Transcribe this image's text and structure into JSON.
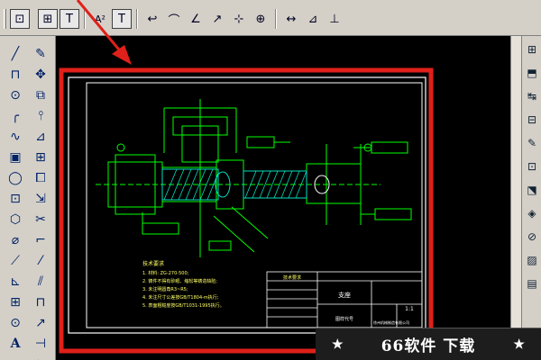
{
  "toolbar": {
    "buttons": [
      {
        "name": "zoom-extents-icon",
        "glyph": "⊡"
      },
      {
        "name": "zoom-window-icon",
        "glyph": "⊞"
      },
      {
        "name": "text-style-icon",
        "glyph": "T"
      },
      {
        "name": "superscript-text-icon",
        "glyph": "A²"
      },
      {
        "name": "multiline-text-icon",
        "glyph": "T"
      },
      {
        "name": "arrow-left-icon",
        "glyph": "↩"
      },
      {
        "name": "arc-icon",
        "glyph": "⌒"
      },
      {
        "name": "slope-icon",
        "glyph": "∠"
      },
      {
        "name": "leader-icon",
        "glyph": "↗"
      },
      {
        "name": "node-icon",
        "glyph": "⊹"
      },
      {
        "name": "center-mark-icon",
        "glyph": "⊕"
      },
      {
        "name": "dimension-linear-icon",
        "glyph": "↔"
      },
      {
        "name": "dimension-angle-icon",
        "glyph": "⊿"
      },
      {
        "name": "dimension-ordinate-icon",
        "glyph": "⊥"
      }
    ]
  },
  "left_tools_a": [
    "╱",
    "⊓",
    "⊙",
    "╭",
    "∿",
    "▣",
    "◯",
    "⊡",
    "⬡",
    "⌀",
    "⟋",
    "⊾",
    "⊞",
    "⊙",
    "A"
  ],
  "left_tools_b": [
    "✎",
    "✥",
    "⧉",
    "⫯",
    "⊿",
    "⊞",
    "⧠",
    "⇲",
    "✂",
    "⌐",
    "⁄",
    "⫽",
    "⊓",
    "↗",
    "⊣",
    "⇆"
  ],
  "right_tools": [
    "⊞",
    "⬒",
    "↹",
    "⊟",
    "✎",
    "⊡",
    "⬔",
    "◈",
    "⊘",
    "▨",
    "▤"
  ],
  "drawing": {
    "notes_title": "技术要求",
    "notes": [
      "1. 材料: ZG-270-500;",
      "2. 铸件不得有砂眼、缩松等铸造缺陷;",
      "3. 未注明圆角R3~R5;",
      "4. 未注尺寸公差按GB/T1804-m执行;",
      "5. 表面粗糙度按GB/T1031-1995执行。"
    ],
    "title_block_header": "技术要求",
    "part_name": "支座",
    "scale": "1:1",
    "drawn_label": "图样代号",
    "company": "徐州机械制造有限公司"
  },
  "watermark": {
    "left_star": "★",
    "text": "66软件 下载",
    "right_star": "★"
  },
  "colors": {
    "annotation_arrow": "#e0201a",
    "highlight_border": "#e0201a",
    "drawing_lines": "#00ff00",
    "hatch": "#00e0c0",
    "frame_lines": "#ffffff"
  }
}
